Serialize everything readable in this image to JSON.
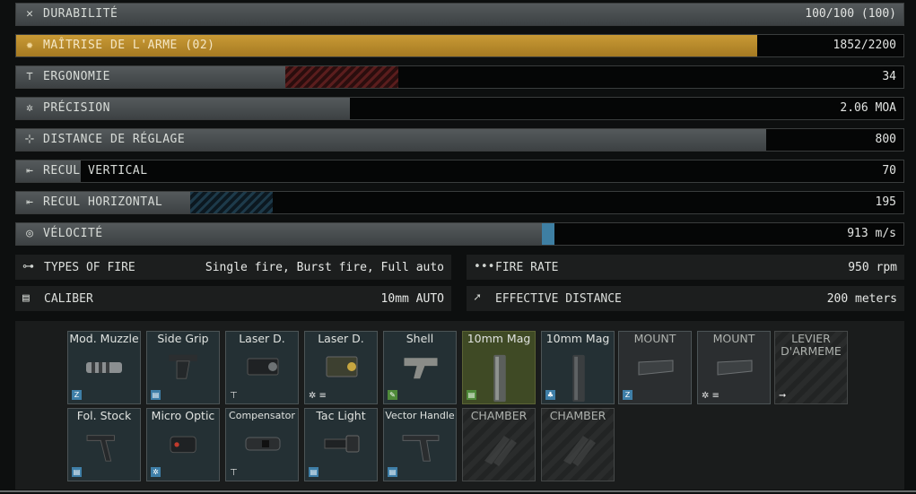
{
  "stats": [
    {
      "label": "DURABILITÉ",
      "value": "100/100 (100)",
      "icon": "wrench-icon",
      "glyph": "✕"
    },
    {
      "label": "MAÎTRISE DE L'ARME (02)",
      "value": "1852/2200",
      "icon": "mastery-icon",
      "glyph": "✹",
      "level": 0.84
    },
    {
      "label": "ERGONOMIE",
      "value": "34",
      "icon": "ergonomics-icon",
      "glyph": "⊤"
    },
    {
      "label": "PRÉCISION",
      "value": "2.06 MOA",
      "icon": "accuracy-icon",
      "glyph": "✲"
    },
    {
      "label": "DISTANCE DE RÉGLAGE",
      "value": "800",
      "icon": "sighting-range-icon",
      "glyph": "⊹"
    },
    {
      "label": "RECUL VERTICAL",
      "value": "70",
      "icon": "vertical-recoil-icon",
      "glyph": "⇤"
    },
    {
      "label": "RECUL HORIZONTAL",
      "value": "195",
      "icon": "horizontal-recoil-icon",
      "glyph": "⇤"
    },
    {
      "label": "VÉLOCITÉ",
      "value": "913 m/s",
      "icon": "velocity-icon",
      "glyph": "◎"
    }
  ],
  "info": {
    "fire_types": {
      "label": "TYPES OF FIRE",
      "value": "Single fire, Burst fire, Full auto",
      "glyph": "⊶"
    },
    "fire_rate": {
      "label": "FIRE RATE",
      "value": "950 rpm",
      "glyph": "•••"
    },
    "caliber": {
      "label": "CALIBER",
      "value": "10mm AUTO",
      "glyph": "▤"
    },
    "effective_distance": {
      "label": "EFFECTIVE DISTANCE",
      "value": "200 meters",
      "glyph": "➚"
    }
  },
  "slots_row1": [
    {
      "name": "Mod. Muzzle",
      "badge": "Z"
    },
    {
      "name": "Side Grip",
      "badge": "▤"
    },
    {
      "name": "Laser D.",
      "tag": "⊤"
    },
    {
      "name": "Laser D.",
      "tag": "✲ ≡"
    },
    {
      "name": "Shell",
      "badge": "✎"
    },
    {
      "name": "10mm Mag",
      "badge": "▤"
    },
    {
      "name": "10mm Mag",
      "badge": "♣"
    },
    {
      "name": "MOUNT",
      "badge": "Z"
    },
    {
      "name": "MOUNT",
      "tag": "✲ ≡"
    },
    {
      "name": "LEVIER D'ARMEME",
      "tag": "➞"
    }
  ],
  "slots_row2": [
    {
      "name": "Fol. Stock",
      "badge": "▤"
    },
    {
      "name": "Micro Optic",
      "badge": "✲"
    },
    {
      "name": "Compensator",
      "tag": "⊤"
    },
    {
      "name": "Tac Light",
      "badge": "▤"
    },
    {
      "name": "Vector Handle",
      "badge": "▤"
    },
    {
      "name": "CHAMBER"
    },
    {
      "name": "CHAMBER"
    }
  ],
  "colors": {
    "mastery": "#c99a35",
    "stat_bar": "#4a4f51",
    "negative": "#5a1d1d",
    "positive": "#1d3a4a",
    "slot_bg": "#243034"
  }
}
